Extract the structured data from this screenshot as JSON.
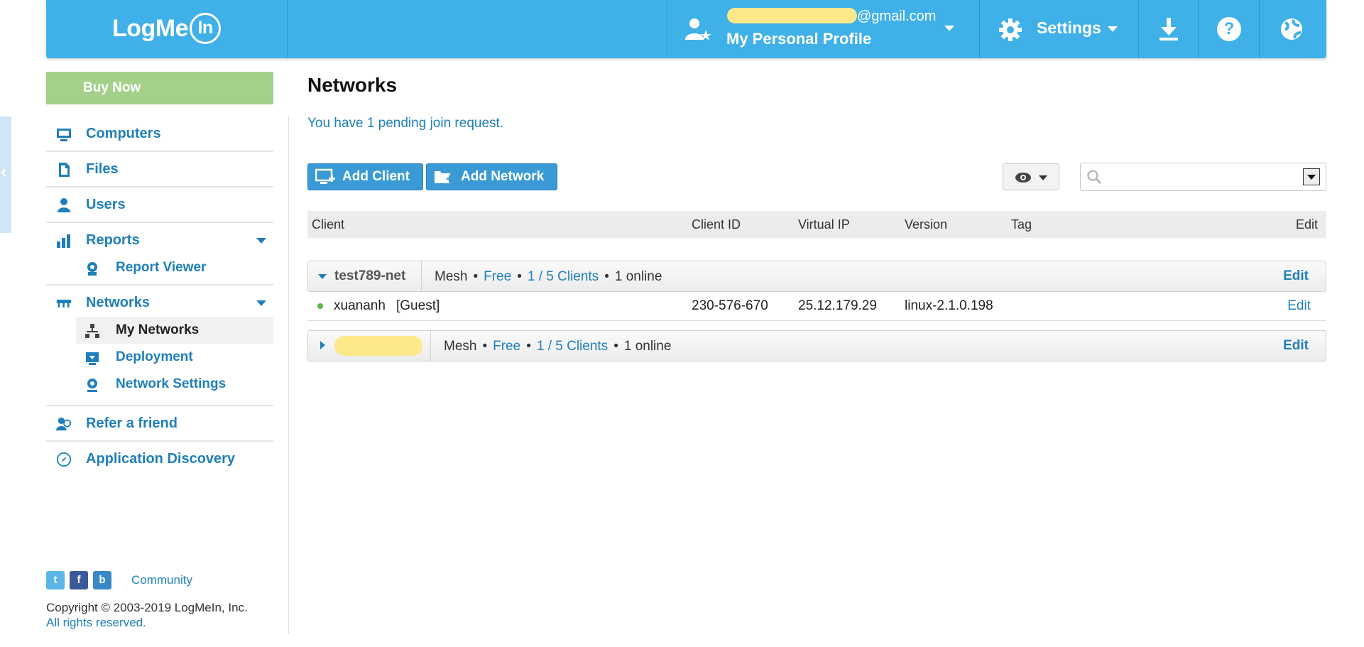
{
  "brand": {
    "logo_text": "LogMe",
    "logo_badge": "In"
  },
  "header": {
    "profile_email_suffix": "@gmail.com",
    "profile_name": "My Personal Profile",
    "settings_label": "Settings"
  },
  "sidebar": {
    "buy_now": "Buy Now",
    "items": [
      {
        "label": "Computers",
        "icon": "monitor-icon"
      },
      {
        "label": "Files",
        "icon": "file-icon"
      },
      {
        "label": "Users",
        "icon": "user-icon"
      },
      {
        "label": "Reports",
        "icon": "bar-chart-icon"
      },
      {
        "label": "Networks",
        "icon": "network-icon"
      },
      {
        "label": "Refer a friend",
        "icon": "refer-icon"
      },
      {
        "label": "Application Discovery",
        "icon": "compass-icon"
      }
    ],
    "reports_sub": [
      {
        "label": "Report Viewer"
      }
    ],
    "networks_sub": [
      {
        "label": "My Networks"
      },
      {
        "label": "Deployment"
      },
      {
        "label": "Network Settings"
      }
    ]
  },
  "footer": {
    "community": "Community",
    "copyright": "Copyright © 2003-2019 LogMeIn, Inc.",
    "rights": "All rights reserved."
  },
  "main": {
    "title": "Networks",
    "pending": "You have 1 pending join request.",
    "add_client": "Add Client",
    "add_network": "Add Network",
    "search_placeholder": "",
    "columns": [
      "Client",
      "Client ID",
      "Virtual IP",
      "Version",
      "Tag",
      "Edit"
    ],
    "networks": [
      {
        "name": "test789-net",
        "type": "Mesh",
        "plan": "Free",
        "clients": "1 / 5 Clients",
        "online": "1 online",
        "edit": "Edit",
        "expanded": true,
        "members": [
          {
            "name": "xuananh",
            "role": "[Guest]",
            "client_id": "230-576-670",
            "virtual_ip": "25.12.179.29",
            "version": "linux-2.1.0.198",
            "tag": "",
            "edit": "Edit",
            "status": "online"
          }
        ]
      },
      {
        "name": "",
        "type": "Mesh",
        "plan": "Free",
        "clients": "1 / 5 Clients",
        "online": "1 online",
        "edit": "Edit",
        "expanded": false
      }
    ]
  },
  "colors": {
    "header_bg": "#3fb0e8",
    "link": "#1f7fb9",
    "buy_now_bg": "#a3d18a",
    "online": "#5cb84a"
  }
}
